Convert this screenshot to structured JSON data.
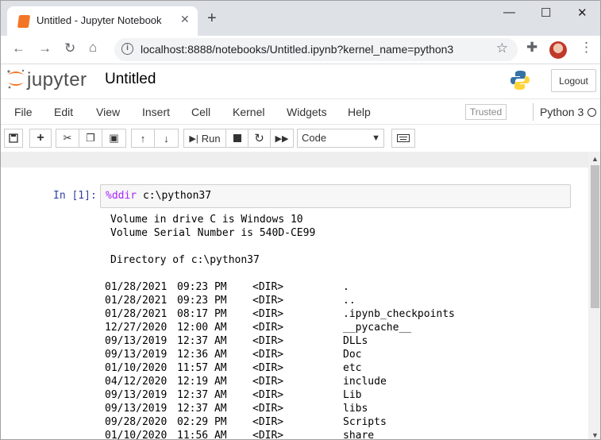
{
  "browser": {
    "tab_title": "Untitled - Jupyter Notebook",
    "tab_close": "✕",
    "new_tab": "+",
    "url": "localhost:8888/notebooks/Untitled.ipynb?kernel_name=python3",
    "window_controls": {
      "minimize": "—",
      "maximize": "☐",
      "close": "✕"
    }
  },
  "jupyter": {
    "logo_text": "jupyter",
    "notebook_title": "Untitled",
    "logout_label": "Logout",
    "menu": [
      "File",
      "Edit",
      "View",
      "Insert",
      "Cell",
      "Kernel",
      "Widgets",
      "Help"
    ],
    "trusted_label": "Trusted",
    "kernel_name": "Python 3",
    "toolbar": {
      "run_label": "Run",
      "cell_type": "Code"
    },
    "colors": {
      "jupyter_orange": "#f37626",
      "prompt_blue": "#303f9f",
      "magic_purple": "#aa22ff"
    }
  },
  "cell": {
    "prompt": "In [1]:",
    "magic": "%ddir",
    "argument": " c:\\python37"
  },
  "output": {
    "volume_line": "Volume in drive C is Windows 10",
    "serial_line": "Volume Serial Number is 540D-CE99",
    "directory_line": "Directory of c:\\python37",
    "entries": [
      {
        "date": "01/28/2021",
        "time": "09:23 PM",
        "type": "<DIR>",
        "name": "."
      },
      {
        "date": "01/28/2021",
        "time": "09:23 PM",
        "type": "<DIR>",
        "name": ".."
      },
      {
        "date": "01/28/2021",
        "time": "08:17 PM",
        "type": "<DIR>",
        "name": ".ipynb_checkpoints"
      },
      {
        "date": "12/27/2020",
        "time": "12:00 AM",
        "type": "<DIR>",
        "name": "__pycache__"
      },
      {
        "date": "09/13/2019",
        "time": "12:37 AM",
        "type": "<DIR>",
        "name": "DLLs"
      },
      {
        "date": "09/13/2019",
        "time": "12:36 AM",
        "type": "<DIR>",
        "name": "Doc"
      },
      {
        "date": "01/10/2020",
        "time": "11:57 AM",
        "type": "<DIR>",
        "name": "etc"
      },
      {
        "date": "04/12/2020",
        "time": "12:19 AM",
        "type": "<DIR>",
        "name": "include"
      },
      {
        "date": "09/13/2019",
        "time": "12:37 AM",
        "type": "<DIR>",
        "name": "Lib"
      },
      {
        "date": "09/13/2019",
        "time": "12:37 AM",
        "type": "<DIR>",
        "name": "libs"
      },
      {
        "date": "09/28/2020",
        "time": "02:29 PM",
        "type": "<DIR>",
        "name": "Scripts"
      },
      {
        "date": "01/10/2020",
        "time": "11:56 AM",
        "type": "<DIR>",
        "name": "share"
      }
    ]
  }
}
